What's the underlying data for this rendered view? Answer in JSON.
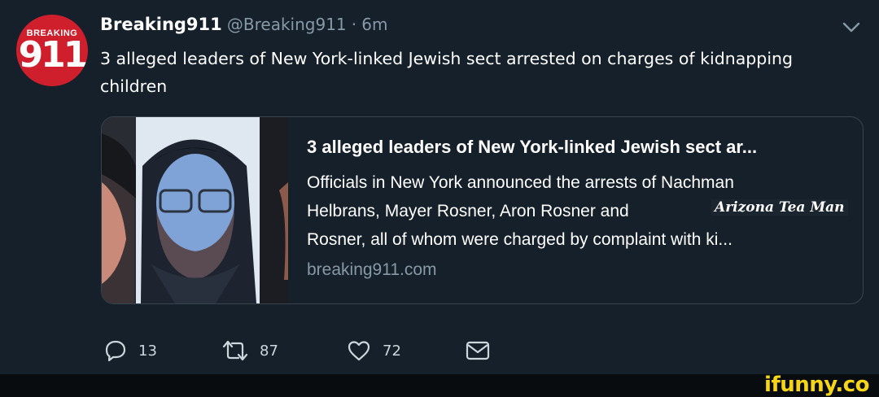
{
  "tweet": {
    "avatar": {
      "top_text": "BREAKING",
      "number": "911"
    },
    "display_name": "Breaking911",
    "handle": "@Breaking911",
    "separator": "·",
    "time": "6m",
    "text": "3 alleged leaders of New York-linked Jewish sect arrested on charges of kidnapping children"
  },
  "card": {
    "title": "3 alleged leaders of New York-linked Jewish sect ar...",
    "description": "Officials in New York announced the arrests of Nachman Helbrans, Mayer Rosner, Aron Rosner and Arizona Tea Man Rosner, all of whom were charged by complaint with ki...",
    "desc_line1": "Officials in New York announced the arrests of Nachman",
    "desc_line2": "Helbrans, Mayer Rosner, Aron Rosner and",
    "desc_line3": "Rosner, all of whom were charged by complaint with ki...",
    "overlay_text": "Arizona Tea Man",
    "domain": "breaking911.com"
  },
  "actions": {
    "reply_count": "13",
    "retweet_count": "87",
    "like_count": "72"
  },
  "watermark": "ifunny.co",
  "icons": [
    "breaking911-avatar",
    "chevron-down-icon",
    "reply-icon",
    "retweet-icon",
    "like-icon",
    "message-icon"
  ],
  "colors": {
    "background": "#15202b",
    "secondary_text": "#8899a6",
    "watermark": "#f5d516",
    "avatar_red": "#d01f2c"
  }
}
